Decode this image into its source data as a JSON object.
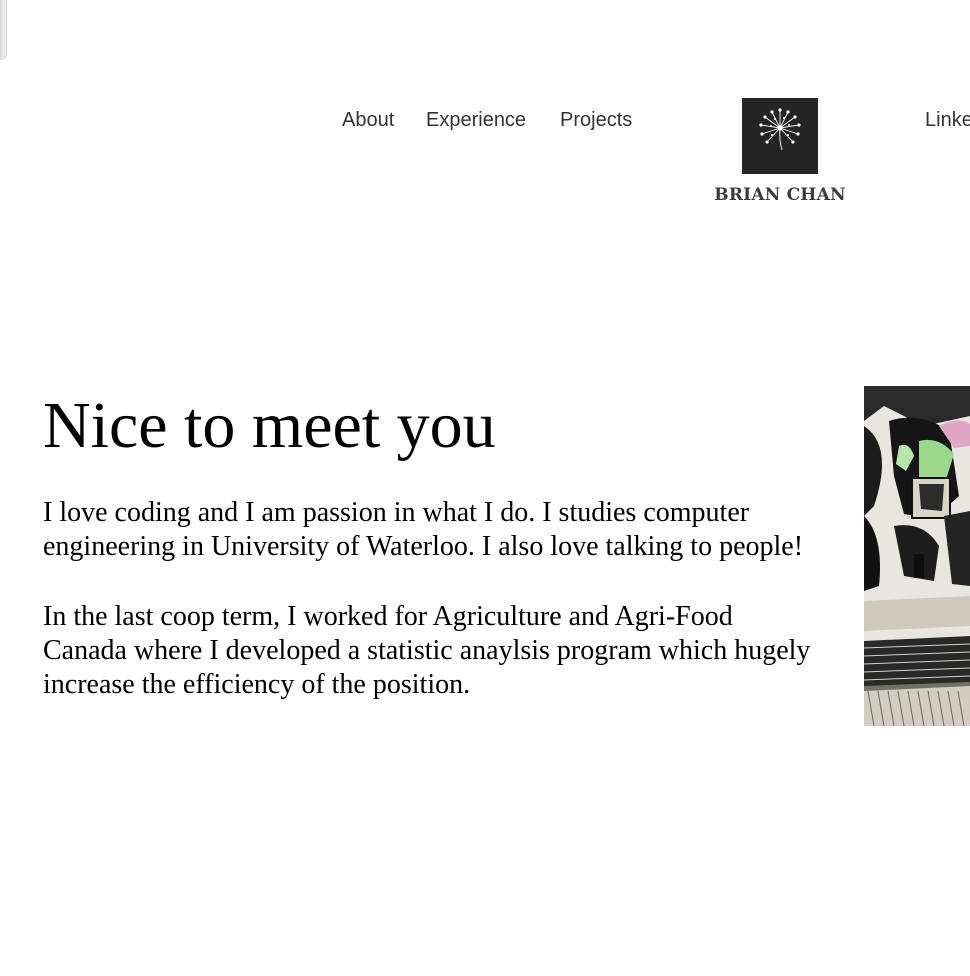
{
  "nav": {
    "about": "About",
    "experience": "Experience",
    "projects": "Projects",
    "linkedin": "Linke"
  },
  "brand": {
    "name": "BRIAN CHAN",
    "logo_icon": "dandelion-icon"
  },
  "hero": {
    "title": "Nice to meet you",
    "paragraph_1": "I love coding and I am passion in what I do. I studies computer engineering in University of Waterloo. I also love talking to people!",
    "paragraph_2": "In the last coop term, I worked for Agriculture and Agri-Food Canada where I developed a statistic anaylsis program which hugely increase the efficiency of the position."
  },
  "colors": {
    "logo_background": "#242424",
    "nav_text": "#333333",
    "body_text": "#000000"
  }
}
